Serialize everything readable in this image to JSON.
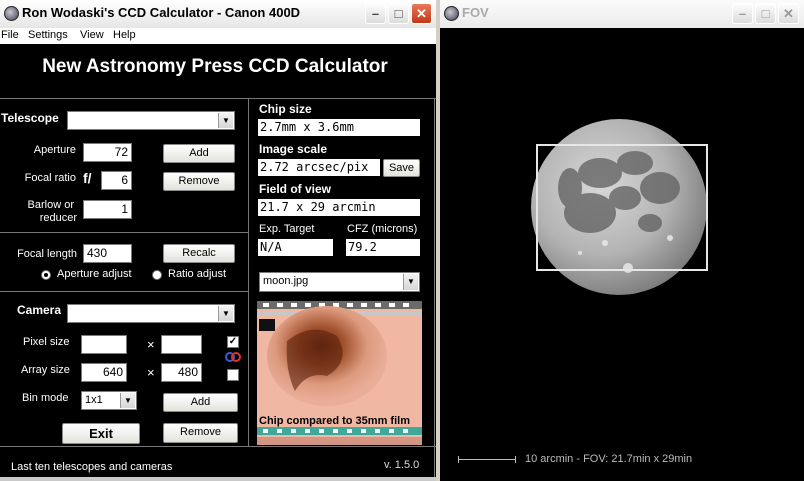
{
  "main_window": {
    "title": "Ron Wodaski's CCD Calculator - Canon 400D",
    "menu": [
      "File",
      "Settings",
      "View",
      "Help"
    ],
    "banner": "New Astronomy Press CCD Calculator",
    "telescope": {
      "section_label": "Telescope",
      "selected": "",
      "aperture_label": "Aperture",
      "aperture_value": "72",
      "focal_ratio_label": "Focal ratio",
      "focal_ratio_prefix": "f/",
      "focal_ratio_value": "6",
      "barlow_label_1": "Barlow or",
      "barlow_label_2": "reducer",
      "barlow_value": "1",
      "add_label": "Add",
      "remove_label": "Remove",
      "focal_length_label": "Focal length",
      "focal_length_value": "430",
      "recalc_label": "Recalc",
      "aperture_adjust_label": "Aperture adjust",
      "ratio_adjust_label": "Ratio adjust",
      "adjust_mode": "aperture"
    },
    "camera": {
      "section_label": "Camera",
      "selected": "",
      "pixel_size_label": "Pixel size",
      "pixel_w": "",
      "pixel_h": "",
      "array_size_label": "Array size",
      "array_w": "640",
      "array_h": "480",
      "times_symbol": "×",
      "bin_mode_label": "Bin mode",
      "bin_value": "1x1",
      "add_label": "Add",
      "remove_label": "Remove",
      "exit_label": "Exit",
      "square_pixels_checked": true,
      "other_checked": false
    },
    "results": {
      "chip_size_label": "Chip size",
      "chip_size_value": "2.7mm x 3.6mm",
      "image_scale_label": "Image scale",
      "image_scale_value": "2.72 arcsec/pix",
      "save_label": "Save",
      "fov_label": "Field of view",
      "fov_value": "21.7 x 29 arcmin",
      "exp_target_label": "Exp. Target",
      "exp_target_value": "N/A",
      "cfz_label": "CFZ (microns)",
      "cfz_value": "79.2",
      "image_file": "moon.jpg",
      "film_caption": "Chip compared to 35mm film"
    },
    "footer_text": "Last ten telescopes and cameras",
    "version": "v. 1.5.0"
  },
  "fov_window": {
    "title": "FOV",
    "scale_bar_text": "10 arcmin - FOV: 21.7min x 29min"
  },
  "colors": {
    "accent_close": "#c2371a",
    "background": "#000000",
    "film_tint": "#e4a08e"
  }
}
